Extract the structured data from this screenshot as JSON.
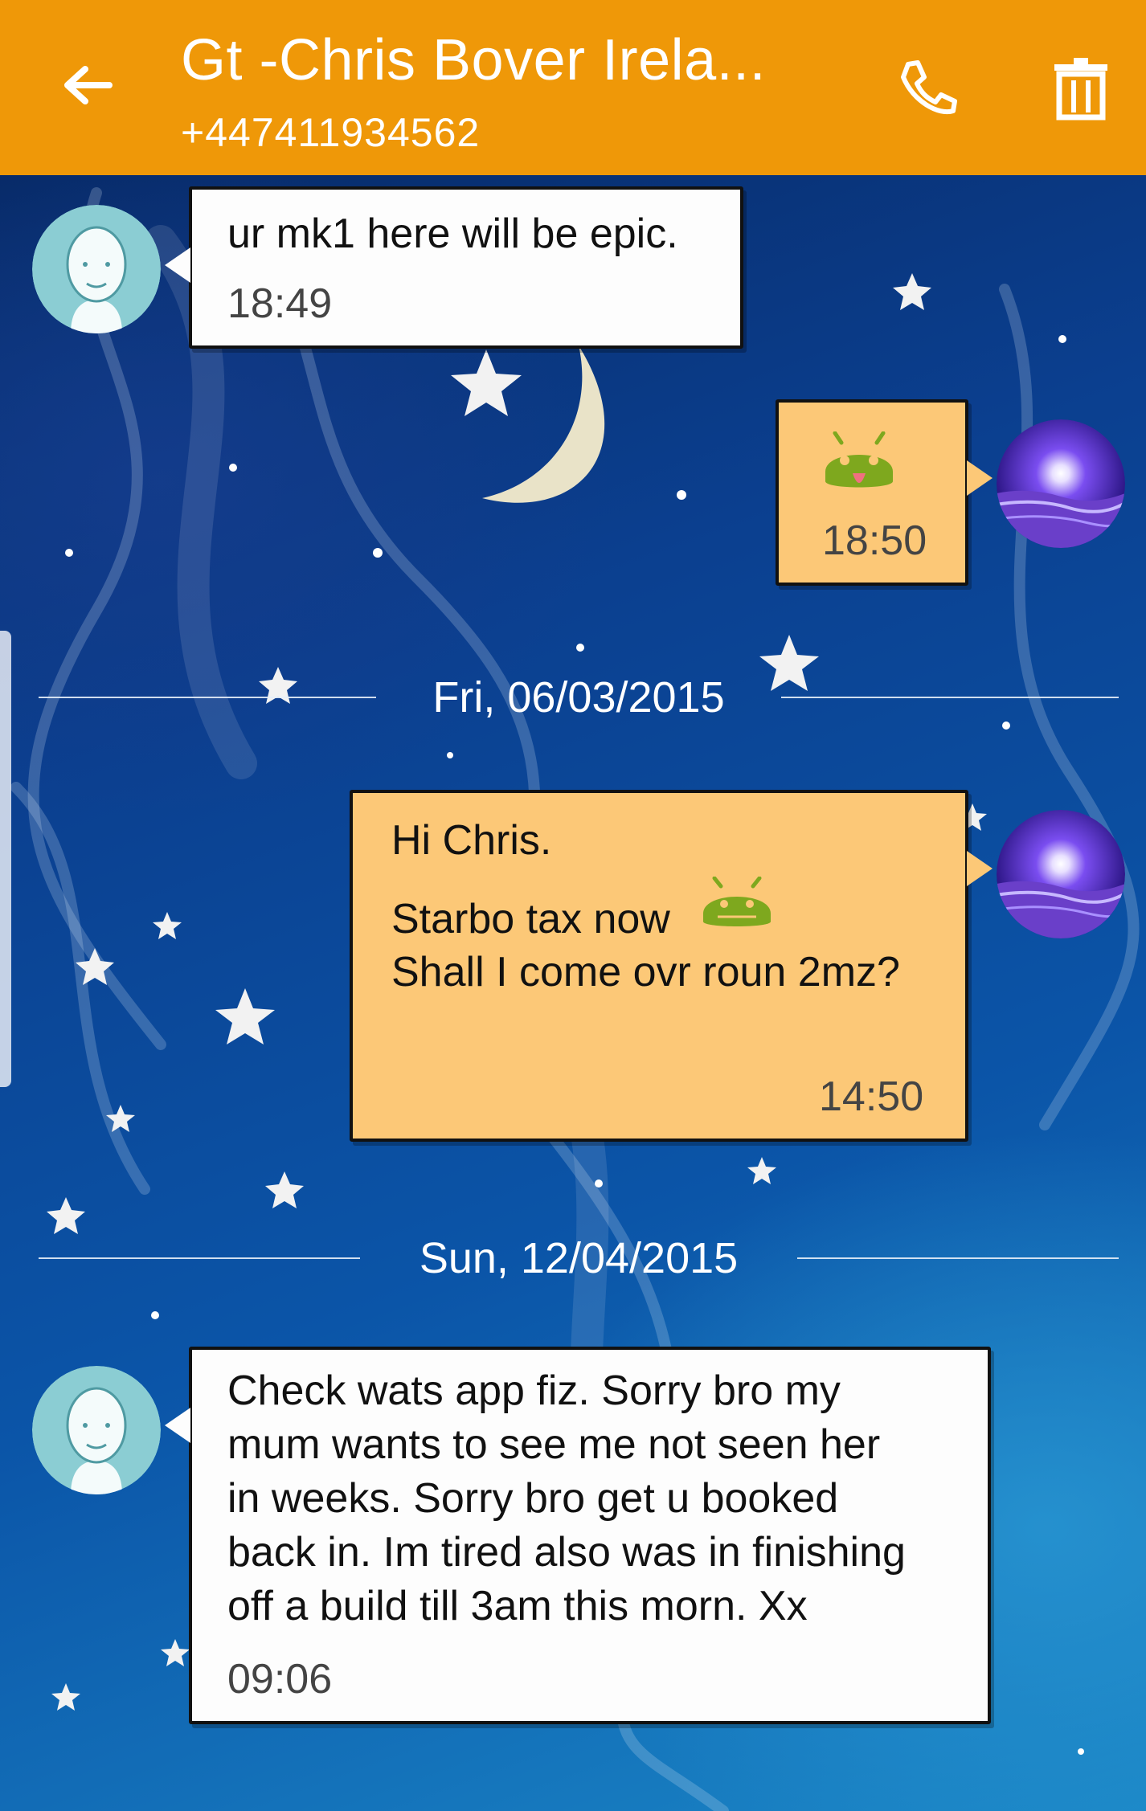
{
  "header": {
    "title": "Gt -Chris Bover Irela...",
    "phone_number": "+447411934562",
    "back_icon": "arrow-left-icon",
    "call_icon": "phone-icon",
    "delete_icon": "trash-icon",
    "background_color": "#ef9808"
  },
  "messages": [
    {
      "direction": "incoming",
      "text": "ur mk1 here will be epic.",
      "time": "18:49"
    },
    {
      "direction": "outgoing",
      "sticker": "android-sticker-icon",
      "time": "18:50"
    },
    {
      "direction": "outgoing",
      "lines": [
        "Hi Chris.",
        "Starbo tax now",
        "Shall I come ovr roun 2mz?"
      ],
      "sticker": "android-emoji-icon",
      "time": "14:50"
    },
    {
      "direction": "incoming",
      "text": "Check wats app fiz. Sorry bro my\nmum wants to see me not seen her\nin weeks. Sorry bro get u booked\nback in. Im tired also was in finishing\noff a build till 3am this morn. Xx",
      "time": "09:06"
    }
  ],
  "date_separators": [
    "Fri, 06/03/2015",
    "Sun, 12/04/2015"
  ],
  "colors": {
    "incoming_bubble": "#fdfdfd",
    "outgoing_bubble": "#fcc877",
    "android_green": "#7ea81e"
  }
}
